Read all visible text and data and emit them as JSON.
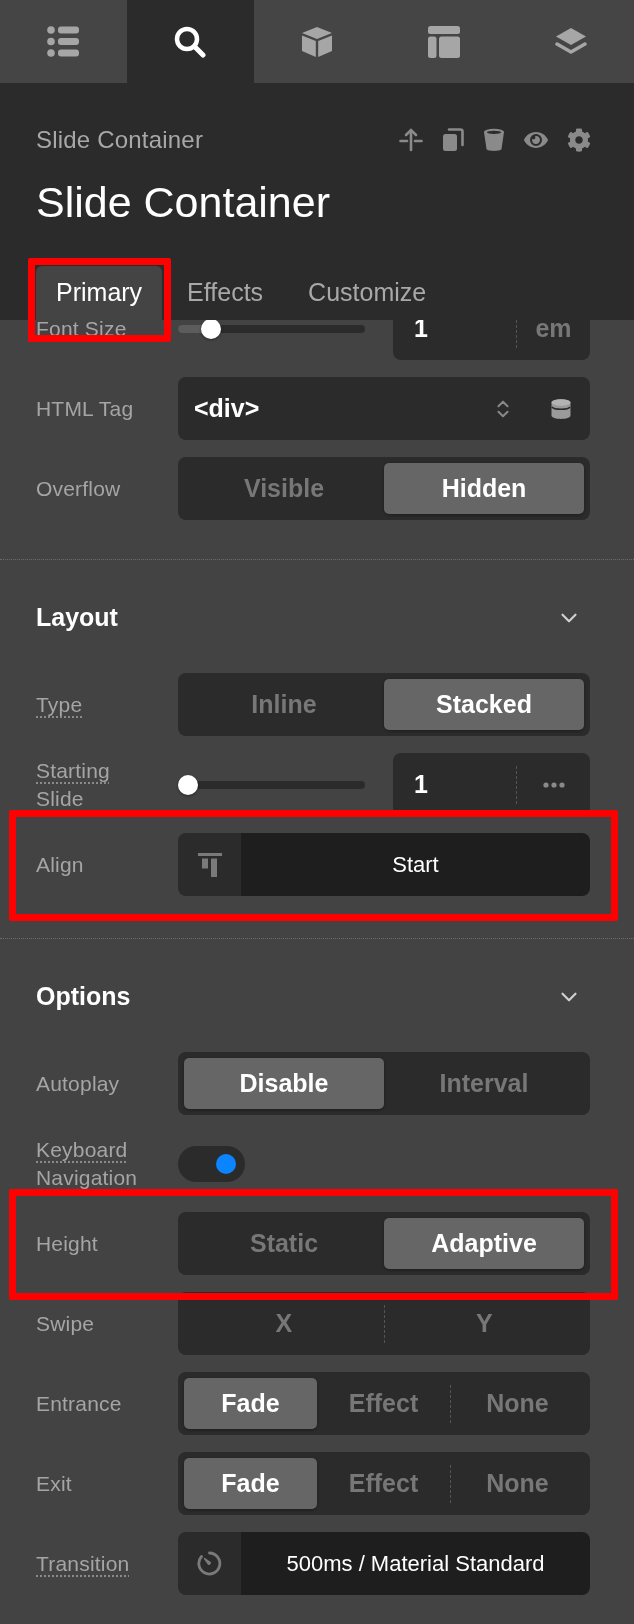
{
  "top_tabs": [
    {
      "kind": "list",
      "selected": false
    },
    {
      "kind": "search",
      "selected": true
    },
    {
      "kind": "cube",
      "selected": false
    },
    {
      "kind": "layout",
      "selected": false
    },
    {
      "kind": "layers",
      "selected": false
    }
  ],
  "header": {
    "breadcrumb": "Slide Container",
    "title": "Slide Container"
  },
  "tabs": [
    {
      "label": "Primary",
      "selected": true,
      "highlighted": true
    },
    {
      "label": "Effects",
      "selected": false,
      "highlighted": false
    },
    {
      "label": "Customize",
      "selected": false,
      "highlighted": false
    }
  ],
  "sections": [
    {
      "rows": [
        {
          "kind": "slider",
          "label": "Font Size",
          "highlighted": false,
          "level": 0.14,
          "value": "1",
          "unit": "em"
        },
        {
          "kind": "select",
          "label": "HTML Tag",
          "tooltip": false,
          "highlighted": false,
          "value": "<div>"
        },
        {
          "kind": "segmented",
          "label": "Overflow",
          "tooltip": false,
          "highlighted": false,
          "options": [
            {
              "label": "Visible",
              "selected": false
            },
            {
              "label": "Hidden",
              "selected": true
            }
          ]
        }
      ]
    },
    {
      "title": "Layout",
      "expanded": true,
      "rows": [
        {
          "kind": "segmented",
          "label": "Type",
          "tooltip": true,
          "highlighted": false,
          "options": [
            {
              "label": "Inline",
              "selected": false
            },
            {
              "label": "Stacked",
              "selected": true
            }
          ]
        },
        {
          "kind": "slider",
          "label": "Starting Slide",
          "tooltip": true,
          "highlighted": false,
          "level": 0,
          "value": "1"
        },
        {
          "kind": "align",
          "label": "Align",
          "tooltip": false,
          "highlighted": true,
          "value": "Start"
        }
      ]
    },
    {
      "title": "Options",
      "expanded": true,
      "rows": [
        {
          "kind": "segmented",
          "label": "Autoplay",
          "tooltip": false,
          "highlighted": false,
          "options": [
            {
              "label": "Disable",
              "selected": true
            },
            {
              "label": "Interval",
              "selected": false
            }
          ]
        },
        {
          "kind": "toggle",
          "label": "Keyboard Navigation",
          "tooltip": true,
          "highlighted": false,
          "on": true
        },
        {
          "kind": "segmented",
          "label": "Height",
          "tooltip": false,
          "highlighted": true,
          "options": [
            {
              "label": "Static",
              "selected": false
            },
            {
              "label": "Adaptive",
              "selected": true
            }
          ]
        },
        {
          "kind": "segmented",
          "label": "Swipe",
          "tooltip": false,
          "highlighted": false,
          "options": [
            {
              "label": "X",
              "selected": false
            },
            {
              "label": "Y",
              "selected": false
            }
          ]
        },
        {
          "kind": "segmented",
          "label": "Entrance",
          "tooltip": false,
          "highlighted": false,
          "options": [
            {
              "label": "Fade",
              "selected": true
            },
            {
              "label": "Effect",
              "selected": false
            },
            {
              "label": "None",
              "selected": false
            }
          ]
        },
        {
          "kind": "segmented",
          "label": "Exit",
          "tooltip": false,
          "highlighted": false,
          "options": [
            {
              "label": "Fade",
              "selected": true
            },
            {
              "label": "Effect",
              "selected": false
            },
            {
              "label": "None",
              "selected": false
            }
          ]
        },
        {
          "kind": "transition",
          "label": "Transition",
          "tooltip": true,
          "highlighted": false,
          "value": "500ms / Material Standard"
        }
      ]
    }
  ]
}
